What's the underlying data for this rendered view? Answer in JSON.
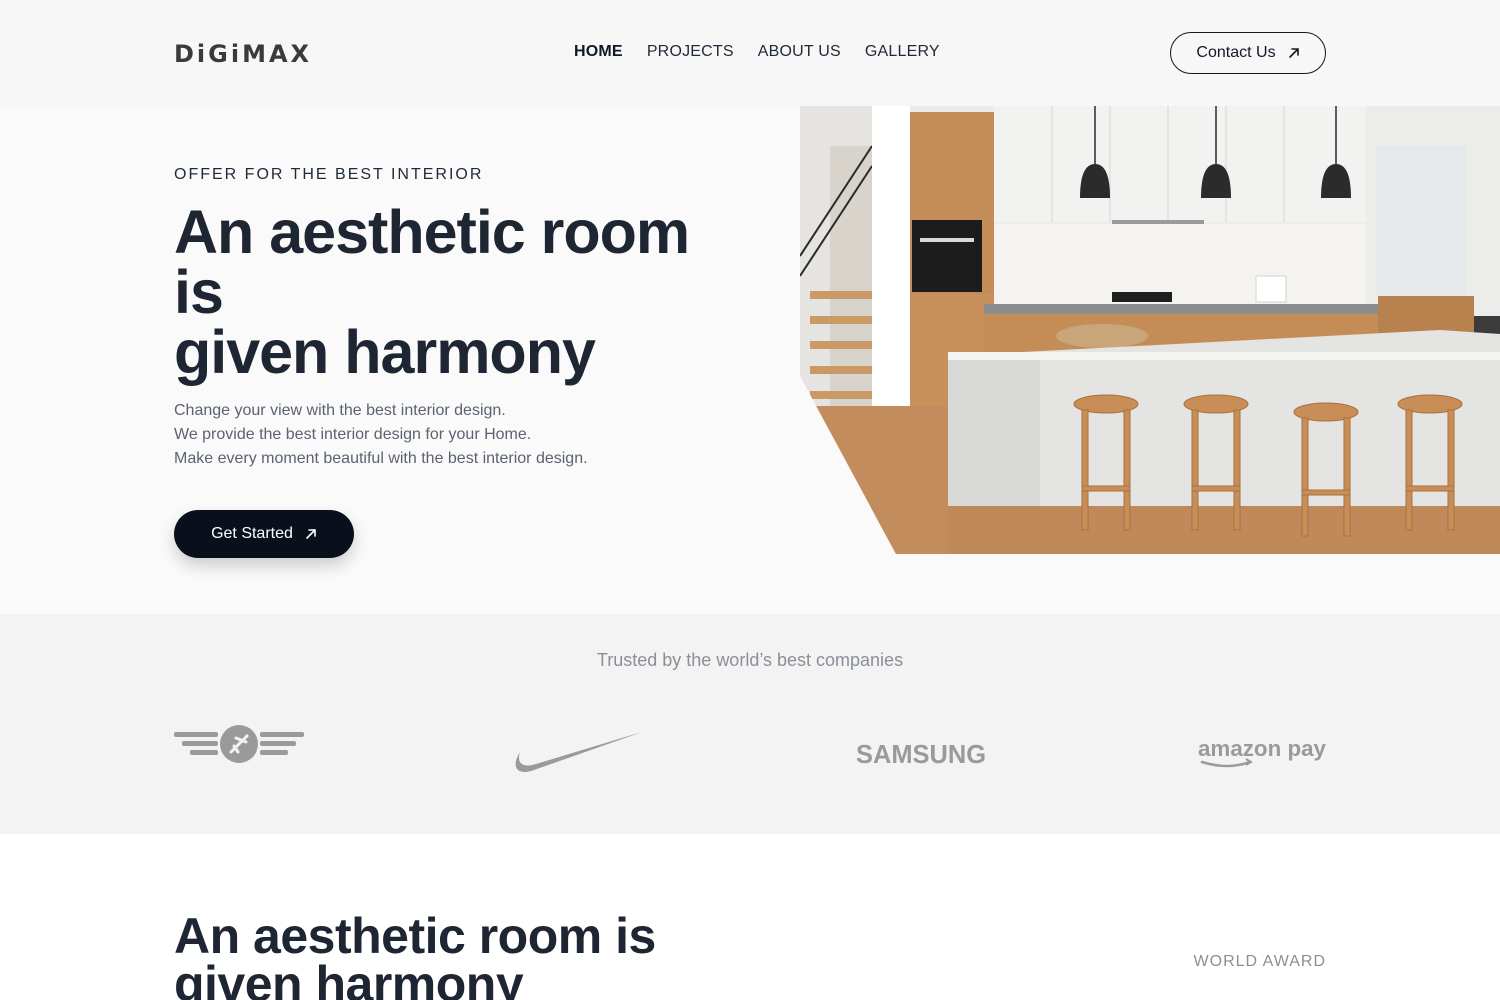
{
  "brand": {
    "logo_text": "DiGiMAX"
  },
  "nav": {
    "items": [
      {
        "label": "HOME",
        "active": true
      },
      {
        "label": "PROJECTS",
        "active": false
      },
      {
        "label": "ABOUT US",
        "active": false
      },
      {
        "label": "GALLERY",
        "active": false
      }
    ]
  },
  "header": {
    "contact_label": "Contact Us",
    "contact_icon": "arrow-up-right-icon"
  },
  "hero": {
    "eyebrow": "OFFER FOR THE BEST INTERIOR",
    "title_lines": [
      "An aesthetic room",
      "is",
      "given harmony"
    ],
    "desc_lines": [
      "Change your view with the best interior design.",
      "We provide the best interior design for your Home.",
      "Make every moment beautiful with the best interior design."
    ],
    "cta_label": "Get Started",
    "image": "kitchen-interior-photo"
  },
  "trusted": {
    "title": "Trusted by the world’s best companies",
    "logos": [
      "aviation-wings-logo",
      "nike-swoosh-logo",
      "SAMSUNG",
      "amazon pay"
    ]
  },
  "section2": {
    "title": "An aesthetic room is given harmony",
    "award_label": "WORLD AWARD"
  },
  "colors": {
    "dark": "#0a0f1c",
    "heading": "#1e2533",
    "muted": "#8a8f98",
    "logo_gray": "#9a9a9a"
  }
}
